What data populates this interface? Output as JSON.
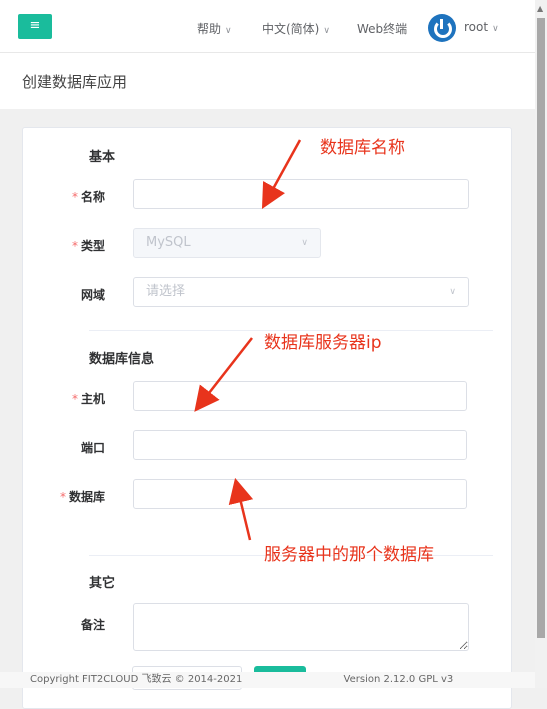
{
  "header": {
    "help": "帮助",
    "language": "中文(简体)",
    "web_terminal": "Web终端",
    "user": "root"
  },
  "page": {
    "title": "创建数据库应用"
  },
  "sections": {
    "basic": "基本",
    "db_info": "数据库信息",
    "other": "其它"
  },
  "fields": {
    "name": {
      "label": "名称",
      "required": "*",
      "value": ""
    },
    "type": {
      "label": "类型",
      "required": "*",
      "value": "MySQL"
    },
    "domain": {
      "label": "网域",
      "placeholder": "请选择"
    },
    "host": {
      "label": "主机",
      "required": "*",
      "value": ""
    },
    "port": {
      "label": "端口",
      "value": ""
    },
    "database": {
      "label": "数据库",
      "required": "*",
      "value": ""
    },
    "comment": {
      "label": "备注",
      "value": ""
    }
  },
  "annotations": {
    "a1": "数据库名称",
    "a2": "数据库服务器ip",
    "a3": "服务器中的那个数据库"
  },
  "footer": {
    "copyright": "Copyright FIT2CLOUD 飞致云 © 2014-2021",
    "version": "Version 2.12.0 GPL v3"
  },
  "colors": {
    "accent": "#1abc9c",
    "annotation": "#e8341c",
    "required": "#f56c6c"
  }
}
